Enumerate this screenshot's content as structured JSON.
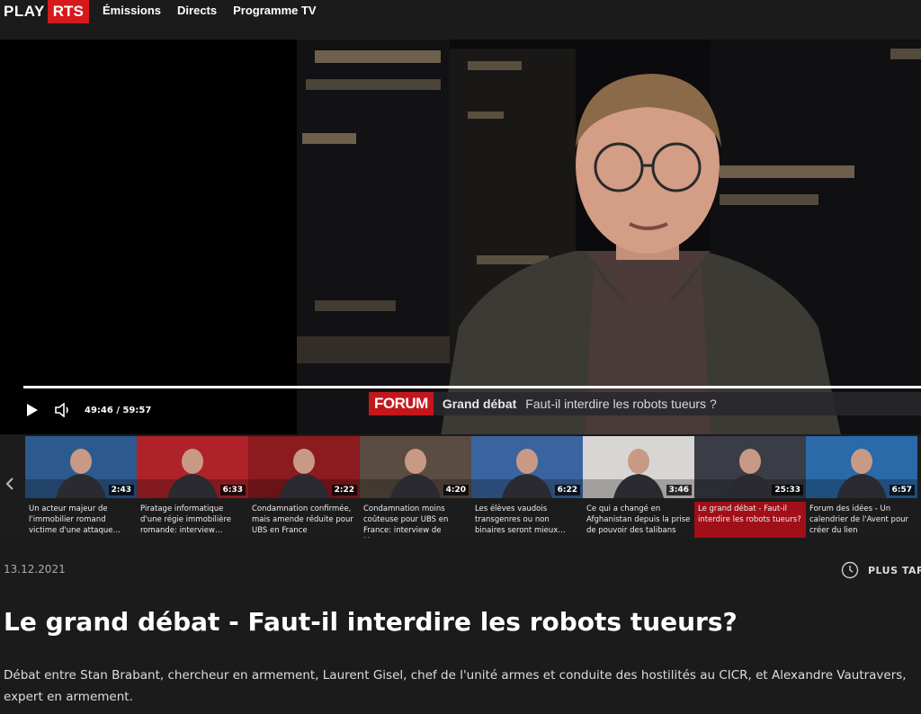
{
  "logo": {
    "play": "PLAY",
    "rts": "RTS"
  },
  "nav": [
    {
      "label": "Émissions"
    },
    {
      "label": "Directs"
    },
    {
      "label": "Programme TV"
    }
  ],
  "player": {
    "time": "49:46 / 59:57",
    "progress_fraction": 0.83,
    "lower_third": {
      "tag": "FORUM",
      "title": "Grand débat",
      "subtitle": "Faut-il interdire les robots tueurs ?"
    }
  },
  "carousel": [
    {
      "title": "Un acteur majeur de l'immobilier romand victime d'une attaque…",
      "duration": "2:43"
    },
    {
      "title": "Piratage informatique d'une régie immobilière romande: interview…",
      "duration": "6:33"
    },
    {
      "title": "Condamnation confirmée, mais amende réduite pour UBS en France",
      "duration": "2:22"
    },
    {
      "title": "Condamnation moins coûteuse pour UBS en France: interview de Marc…",
      "duration": "4:20"
    },
    {
      "title": "Les élèves vaudois transgenres ou non binaires seront mieux…",
      "duration": "6:22"
    },
    {
      "title": "Ce qui a changé en Afghanistan depuis la prise de pouvoir des talibans",
      "duration": "3:46"
    },
    {
      "title": "Le grand débat - Faut-il interdire les robots tueurs?",
      "duration": "25:33",
      "active": true
    },
    {
      "title": "Forum des idées - Un calendrier de l'Avent pour créer du lien",
      "duration": "6:57"
    }
  ],
  "meta": {
    "date": "13.12.2021",
    "later_label": "PLUS TARD"
  },
  "episode": {
    "title": "Le grand débat - Faut-il interdire les robots tueurs?",
    "description": "Débat entre Stan Brabant, chercheur en armement, Laurent Gisel, chef de l'unité armes et conduite des hostilités au CICR, et Alexandre Vautravers, expert en armement."
  },
  "colors": {
    "brand_red": "#d7191c",
    "active_card": "#a10f18",
    "background": "#1b1b1b"
  },
  "icons": [
    "play-icon",
    "volume-icon",
    "chevron-left-icon",
    "clock-icon"
  ]
}
